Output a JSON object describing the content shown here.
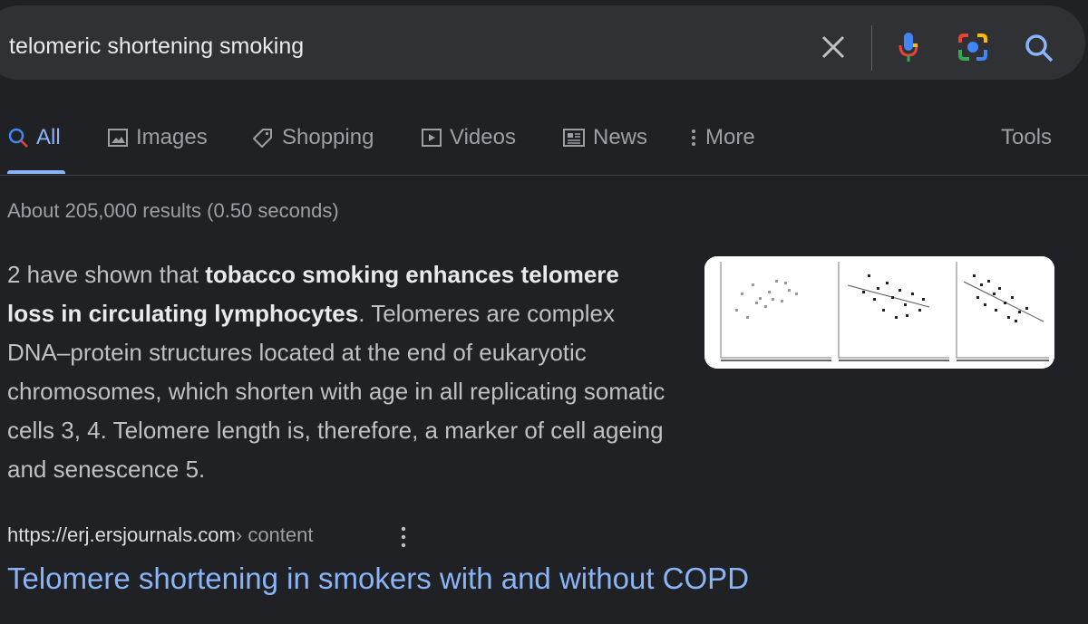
{
  "search": {
    "query": "telomeric shortening smoking"
  },
  "tabs": [
    {
      "label": "All",
      "icon": "search-icon",
      "active": true
    },
    {
      "label": "Images",
      "icon": "image-icon"
    },
    {
      "label": "Shopping",
      "icon": "tag-icon"
    },
    {
      "label": "Videos",
      "icon": "play-icon"
    },
    {
      "label": "News",
      "icon": "newspaper-icon"
    },
    {
      "label": "More",
      "icon": "kebab-icon"
    }
  ],
  "tools_label": "Tools",
  "stats": "About 205,000 results (0.50 seconds)",
  "snippet": {
    "pre": "2 have shown that ",
    "bold": "tobacco smoking enhances telomere loss in circulating lymphocytes",
    "post": ". Telomeres are complex DNA–protein structures located at the end of eukaryotic chromosomes, which shorten with age in all replicating somatic cells 3, 4. Telomere length is, therefore, a marker of cell ageing and senescence 5."
  },
  "result": {
    "url": "https://erj.ersjournals.com",
    "path": " › content",
    "title": "Telomere shortening in smokers with and without COPD"
  },
  "colors": {
    "background": "#202124",
    "searchbar": "#303134",
    "link": "#8ab4f8",
    "text": "#bdc1c6"
  }
}
